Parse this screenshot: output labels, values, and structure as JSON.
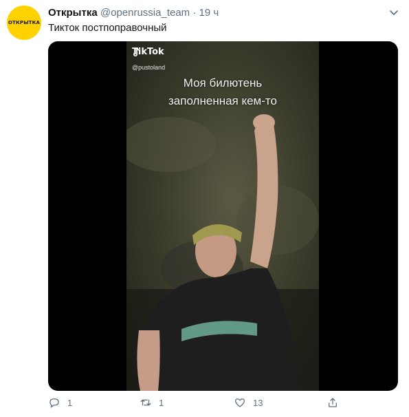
{
  "tweet": {
    "avatar_text": "ОТКРЫТКА",
    "display_name": "Открытка",
    "handle": "@openrussia_team",
    "separator": "·",
    "time": "19 ч",
    "text": "Тикток постпоправочный"
  },
  "video": {
    "watermark_brand": "TikTok",
    "watermark_user": "@pustoland",
    "caption_line1": "Моя билютень",
    "caption_line2": "заполненная кем-то"
  },
  "actions": {
    "reply_count": "1",
    "retweet_count": "1",
    "like_count": "13"
  },
  "colors": {
    "avatar_bg": "#ffd200",
    "secondary_text": "#5b7083",
    "icon": "#5b7083"
  }
}
